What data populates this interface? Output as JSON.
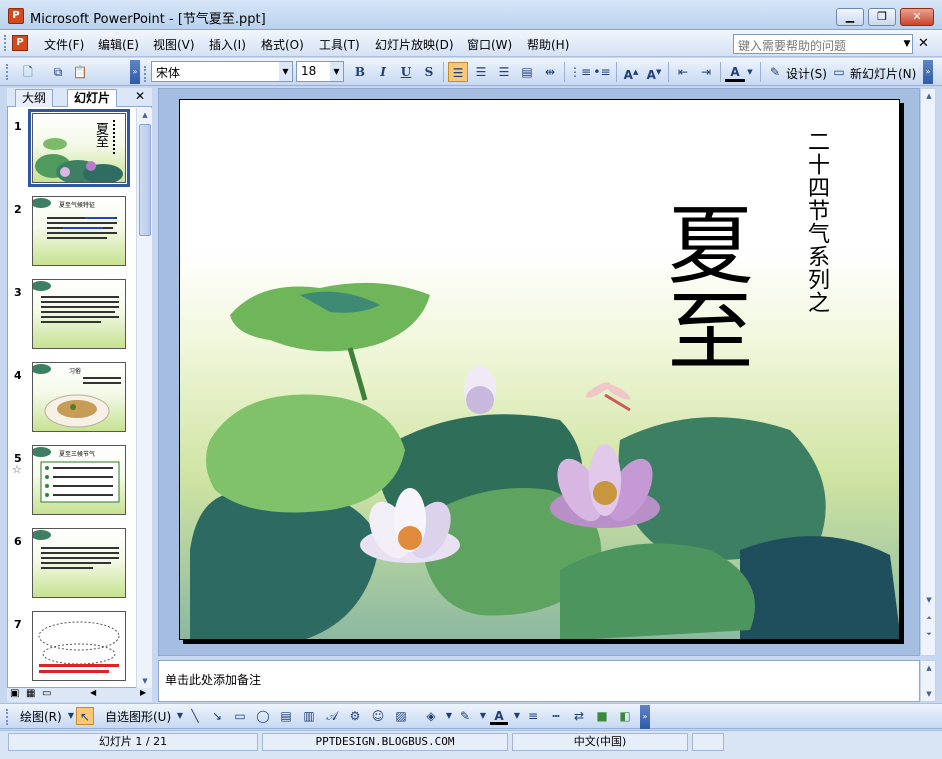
{
  "window": {
    "title": "Microsoft PowerPoint - [节气夏至.ppt]",
    "app_icon": "powerpoint-icon"
  },
  "menu": {
    "items": [
      "文件(F)",
      "编辑(E)",
      "视图(V)",
      "插入(I)",
      "格式(O)",
      "工具(T)",
      "幻灯片放映(D)",
      "窗口(W)",
      "帮助(H)"
    ],
    "help_placeholder": "键入需要帮助的问题"
  },
  "format_toolbar": {
    "font_name": "宋体",
    "font_size": "18",
    "bold": "B",
    "italic": "I",
    "underline": "U",
    "shadow": "S",
    "design_label": "设计(S)",
    "new_slide_label": "新幻灯片(N)"
  },
  "left_panel": {
    "tabs": [
      "大纲",
      "幻灯片"
    ],
    "active_tab": "幻灯片",
    "slide_numbers": [
      "1",
      "2",
      "3",
      "4",
      "5",
      "6",
      "7"
    ],
    "thumb1_title": "夏至",
    "thumb2_title": "夏至气候特征",
    "thumb4_title": "习俗",
    "thumb5_title": "夏至三候节气",
    "star": "☆"
  },
  "slide": {
    "title": "夏至",
    "subtitle": "二十四节气系列之"
  },
  "notes": {
    "placeholder": "单击此处添加备注"
  },
  "drawing_toolbar": {
    "draw_label": "绘图(R)",
    "autoshapes_label": "自选图形(U)"
  },
  "status": {
    "slide_position": "幻灯片 1 / 21",
    "template": "PPTDESIGN.BLOGBUS.COM",
    "language": "中文(中国)"
  },
  "colors": {
    "accent": "#2d58a7",
    "active_button": "#f8c877"
  }
}
